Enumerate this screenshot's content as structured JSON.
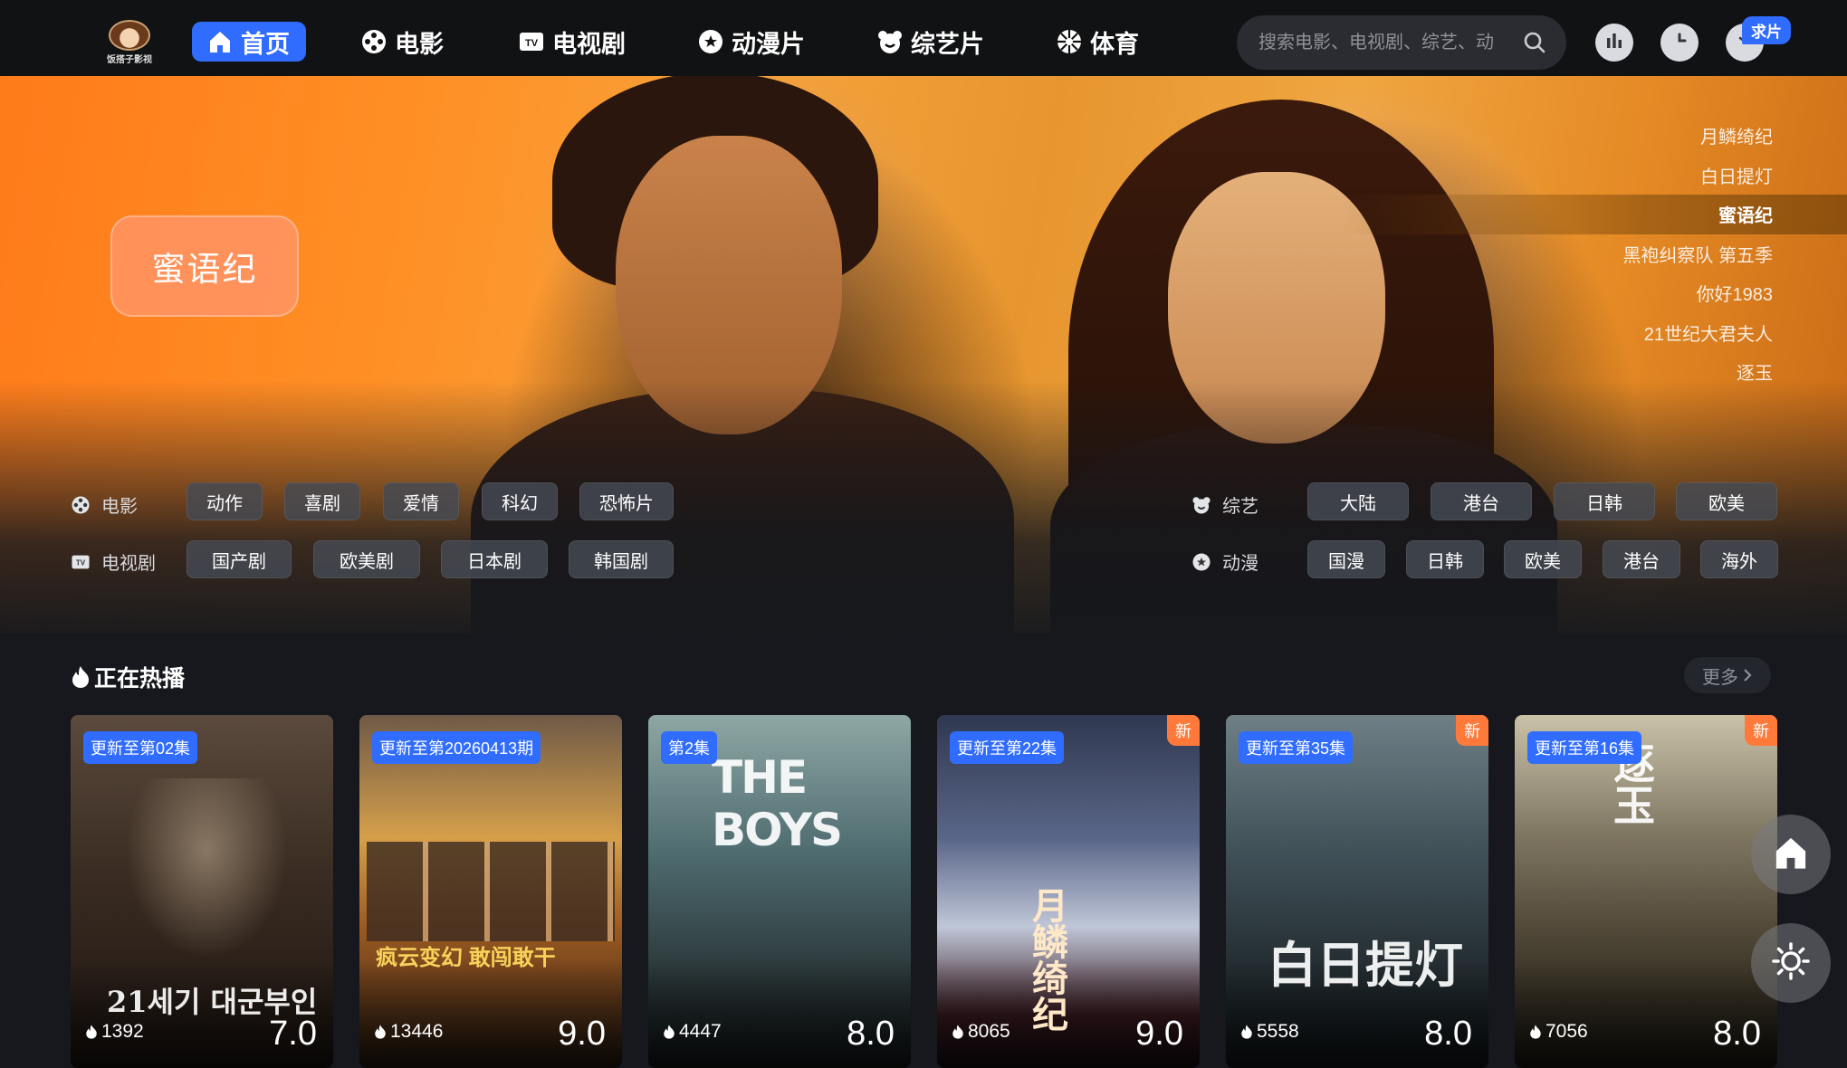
{
  "brand": {
    "logo_text": "饭搭子影视"
  },
  "nav": {
    "items": [
      {
        "label": "首页",
        "icon": "home-icon",
        "active": true
      },
      {
        "label": "电影",
        "icon": "film-reel-icon"
      },
      {
        "label": "电视剧",
        "icon": "tv-icon"
      },
      {
        "label": "动漫片",
        "icon": "star-badge-icon"
      },
      {
        "label": "综艺片",
        "icon": "bear-icon"
      },
      {
        "label": "体育",
        "icon": "football-icon"
      }
    ],
    "search_placeholder": "搜索电影、电视剧、综艺、动",
    "request_badge": "求片"
  },
  "hero": {
    "featured_title": "蜜语纪",
    "list": [
      "月鳞绮纪",
      "白日提灯",
      "蜜语纪",
      "黑袍纠察队 第五季",
      "你好1983",
      "21世纪大君夫人",
      "逐玉"
    ],
    "active_index": 2
  },
  "categories": {
    "movie": {
      "label": "电影",
      "chips": [
        "动作",
        "喜剧",
        "爱情",
        "科幻",
        "恐怖片"
      ]
    },
    "tv": {
      "label": "电视剧",
      "chips": [
        "国产剧",
        "欧美剧",
        "日本剧",
        "韩国剧"
      ]
    },
    "variety": {
      "label": "综艺",
      "chips": [
        "大陆",
        "港台",
        "日韩",
        "欧美"
      ]
    },
    "anime": {
      "label": "动漫",
      "chips": [
        "国漫",
        "日韩",
        "欧美",
        "港台",
        "海外"
      ]
    }
  },
  "section": {
    "title": "正在热播",
    "more": "更多",
    "cards": [
      {
        "episode": "更新至第02集",
        "heat": "1392",
        "score": "7.0",
        "new": "",
        "poster_text": "21세기 대군부인"
      },
      {
        "episode": "更新至第20260413期",
        "heat": "13446",
        "score": "9.0",
        "new": "",
        "poster_text": "疯云变幻  敢闯敢干"
      },
      {
        "episode": "第2集",
        "heat": "4447",
        "score": "8.0",
        "new": "",
        "poster_text": "THE BOYS"
      },
      {
        "episode": "更新至第22集",
        "heat": "8065",
        "score": "9.0",
        "new": "新",
        "poster_text": "月鳞绮纪"
      },
      {
        "episode": "更新至第35集",
        "heat": "5558",
        "score": "8.0",
        "new": "新",
        "poster_text": "白日提灯"
      },
      {
        "episode": "更新至第16集",
        "heat": "7056",
        "score": "8.0",
        "new": "新",
        "poster_text": "逐玉"
      }
    ]
  },
  "colors": {
    "accent": "#2f6cff",
    "new_badge": "#ff7a3a",
    "background": "#16181d"
  }
}
